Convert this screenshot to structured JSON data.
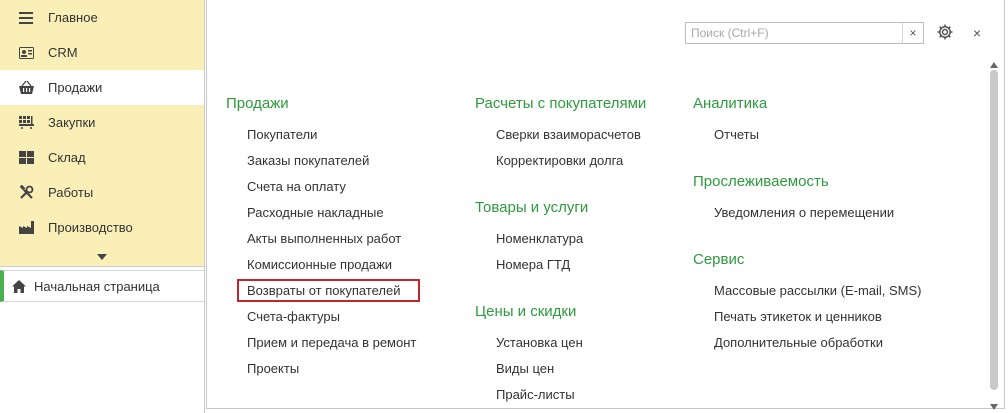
{
  "sidebar": {
    "sections": [
      {
        "label": "Главное",
        "icon": "menu-lines-icon"
      },
      {
        "label": "CRM",
        "icon": "contact-card-icon"
      },
      {
        "label": "Продажи",
        "icon": "basket-icon"
      },
      {
        "label": "Закупки",
        "icon": "truck-icon"
      },
      {
        "label": "Склад",
        "icon": "warehouse-icon"
      },
      {
        "label": "Работы",
        "icon": "tools-icon"
      },
      {
        "label": "Производство",
        "icon": "factory-icon"
      }
    ],
    "active_section": "Продажи",
    "more_icon": "chevron-down-icon",
    "home_label": "Начальная страница",
    "home_icon": "home-icon"
  },
  "toolbar": {
    "search_placeholder": "Поиск (Ctrl+F)",
    "clear_glyph": "×",
    "close_glyph": "×"
  },
  "groups": {
    "prodazhi": {
      "title": "Продажи",
      "items": [
        "Покупатели",
        "Заказы покупателей",
        "Счета на оплату",
        "Расходные накладные",
        "Акты выполненных работ",
        "Комиссионные продажи",
        "Возвраты от покупателей",
        "Счета-фактуры",
        "Прием и передача в ремонт",
        "Проекты"
      ]
    },
    "raschety": {
      "title": "Расчеты с покупателями",
      "items": [
        "Сверки взаиморасчетов",
        "Корректировки долга"
      ]
    },
    "tovary": {
      "title": "Товары и услуги",
      "items": [
        "Номенклатура",
        "Номера ГТД"
      ]
    },
    "ceny": {
      "title": "Цены и скидки",
      "items": [
        "Установка цен",
        "Виды цен",
        "Прайс-листы"
      ]
    },
    "analitika": {
      "title": "Аналитика",
      "items": [
        "Отчеты"
      ]
    },
    "proslezh": {
      "title": "Прослеживаемость",
      "items": [
        "Уведомления о перемещении"
      ]
    },
    "servis": {
      "title": "Сервис",
      "items": [
        "Массовые рассылки (E-mail, SMS)",
        "Печать этикеток и ценников",
        "Дополнительные обработки"
      ]
    }
  },
  "highlighted_item": "Возвраты от покупателей",
  "colors": {
    "sidebar_bg": "#fbefb8",
    "group_title": "#2e9a3e",
    "highlight_border": "#c0262b",
    "home_accent": "#4caf50"
  }
}
